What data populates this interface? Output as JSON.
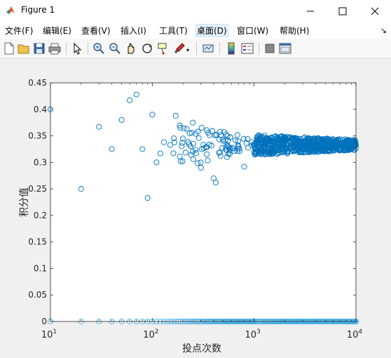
{
  "window": {
    "title": "Figure 1"
  },
  "menu": [
    "文件(F)",
    "编辑(E)",
    "查看(V)",
    "插入(I)",
    "工具(T)",
    "桌面(D)",
    "窗口(W)",
    "帮助(H)"
  ],
  "toolbar": [
    "new-figure",
    "open-file",
    "save",
    "print",
    "pointer",
    "zoom-in",
    "zoom-out",
    "pan",
    "rotate-3d",
    "data-cursor",
    "brush",
    "link-plot",
    "colorbar",
    "legend",
    "hide-plot-tools",
    "show-plot-tools"
  ],
  "colors": {
    "marker": "#0072bd",
    "zero_marker": "#4db3e6",
    "titlebar": "#ffffff",
    "figure_bg": "#f0f0f0"
  },
  "chart_data": {
    "type": "scatter",
    "title": "",
    "xlabel": "投点次数",
    "ylabel": "积分值",
    "xscale": "log",
    "xlim": [
      10,
      10000
    ],
    "ylim": [
      0,
      0.45
    ],
    "x_tick_labels": [
      "10^1",
      "10^2",
      "10^3",
      "10^4"
    ],
    "y_tick_labels": [
      "0",
      "0.05",
      "0.1",
      "0.15",
      "0.2",
      "0.25",
      "0.3",
      "0.35",
      "0.4",
      "0.45"
    ],
    "grid": false,
    "legend": "none",
    "marker": "open-circle",
    "series": [
      {
        "values_sample": [
          [
            10,
            0.4
          ],
          [
            20,
            0.25
          ],
          [
            30,
            0.367
          ],
          [
            40,
            0.325
          ],
          [
            50,
            0.38
          ],
          [
            60,
            0.417
          ],
          [
            70,
            0.428
          ],
          [
            80,
            0.325
          ],
          [
            90,
            0.233
          ],
          [
            100,
            0.39
          ],
          [
            110,
            0.3
          ],
          [
            120,
            0.317
          ],
          [
            130,
            0.338
          ],
          [
            150,
            0.333
          ],
          [
            170,
            0.388
          ],
          [
            200,
            0.345
          ],
          [
            250,
            0.375
          ],
          [
            300,
            0.29
          ],
          [
            400,
            0.27
          ],
          [
            420,
            0.262
          ],
          [
            500,
            0.34
          ],
          [
            700,
            0.33
          ],
          [
            800,
            0.292
          ],
          [
            1000,
            0.32
          ],
          [
            2000,
            0.34
          ],
          [
            5000,
            0.33
          ],
          [
            10000,
            0.333
          ]
        ],
        "band": {
          "x_from": 1000,
          "x_to": 10000,
          "center": 0.333,
          "spread": 0.012
        }
      },
      {
        "x_from": 10,
        "x_to": 10000,
        "value": 0,
        "color": "light-blue"
      }
    ]
  }
}
